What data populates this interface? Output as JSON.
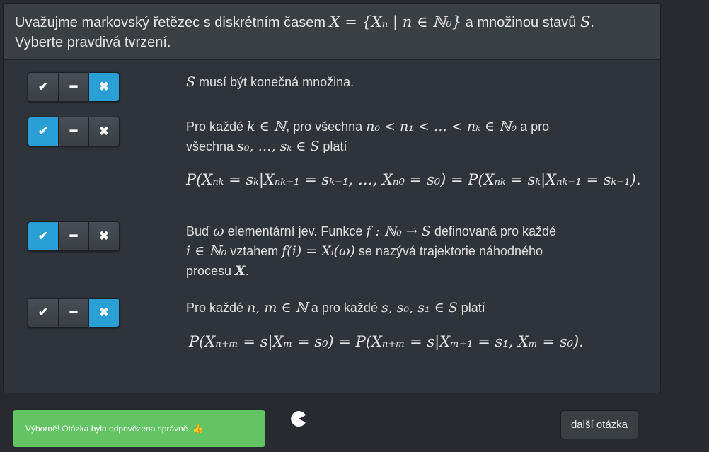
{
  "question": {
    "line1_prefix": "Uvažujme markovský řetězec s diskrétním časem ",
    "line1_math": "X = {Xₙ | n ∈ ℕ₀}",
    "line1_mid": " a množinou stavů ",
    "line1_math2": "S",
    "line1_suffix": ".",
    "line2": "Vyberte pravdivá tvrzení."
  },
  "toggle_labels": {
    "yes": "✔",
    "neutral": "━",
    "no": "✖"
  },
  "statements": [
    {
      "selected": "no",
      "parts": [
        "S",
        " musí být konečná množina."
      ]
    },
    {
      "selected": "yes",
      "p1": "Pro každé ",
      "m1": "k ∈ ℕ",
      "p2": ", pro všechna ",
      "m2": "n₀ < n₁ < … < nₖ ∈ ℕ₀",
      "p3": " a pro",
      "p4": "všechna ",
      "m3": "s₀, …, sₖ ∈ S",
      "p5": " platí",
      "display": "P(Xₙₖ = sₖ|Xₙₖ₋₁ = sₖ₋₁, …, Xₙ₀ = s₀) = P(Xₙₖ = sₖ|Xₙₖ₋₁ = sₖ₋₁)."
    },
    {
      "selected": "yes",
      "p1": "Buď ",
      "m1": "ω",
      "p2": " elementární jev. Funkce ",
      "m2": "f : ℕ₀ → S",
      "p3": " definovaná pro každé",
      "m3": "i ∈ ℕ₀",
      "p4": " vztahem ",
      "m4": "f(i) = Xᵢ(ω)",
      "p5": " se nazývá trajektorie náhodného",
      "p6": "procesu ",
      "m5": "X",
      "p7": "."
    },
    {
      "selected": "no",
      "p1": "Pro každé ",
      "m1": "n, m ∈ ℕ",
      "p2": " a pro každé ",
      "m2": "s, s₀, s₁ ∈ S",
      "p3": " platí",
      "display": "P(Xₙ₊ₘ = s|Xₘ = s₀) = P(Xₙ₊ₘ = s|Xₘ₊₁ = s₁, Xₘ = s₀)."
    }
  ],
  "alert": {
    "text": "Výborně! Otázka byla odpovězena správně. 👍"
  },
  "next_button": {
    "label": "další otázka"
  },
  "colors": {
    "active": "#2a9fd6",
    "success": "#62c462"
  }
}
